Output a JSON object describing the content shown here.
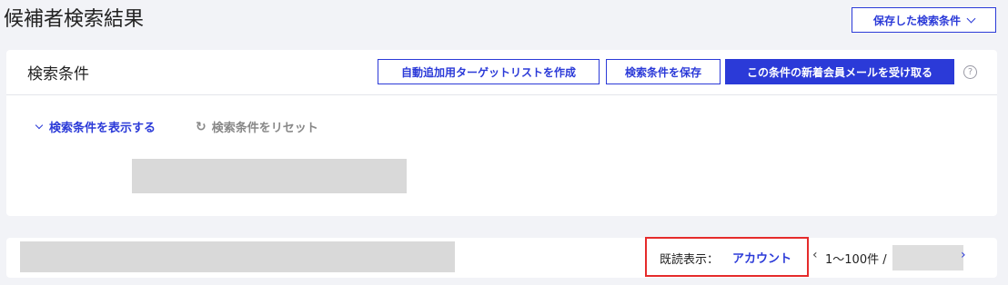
{
  "header": {
    "title": "候補者検索結果",
    "saved_conditions_label": "保存した検索条件"
  },
  "search_card": {
    "title": "検索条件",
    "auto_add_label": "自動追加用ターゲットリストを作成",
    "save_label": "検索条件を保存",
    "mail_label": "この条件の新着会員メールを受け取る",
    "help_icon": "?",
    "show_conditions_label": "検索条件を表示する",
    "reset_label": "検索条件をリセット",
    "reset_icon": "↻"
  },
  "result_bar": {
    "read_display_label": "既読表示：",
    "read_display_value": "アカウント",
    "prev_icon": "‹",
    "range_text": "1〜100件 /",
    "next_icon": "›"
  },
  "colors": {
    "accent": "#2b3ad8",
    "highlight": "#e52b2b",
    "background": "#f2f3f7",
    "redacted": "#d9d9d9"
  }
}
